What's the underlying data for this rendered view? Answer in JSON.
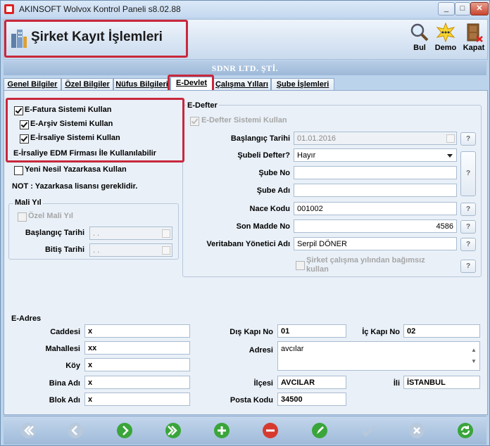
{
  "window": {
    "title": "AKINSOFT Wolvox Kontrol Paneli s8.02.88",
    "minimize": "_",
    "maximize": "□",
    "close": "✕"
  },
  "header": {
    "title": "Şirket Kayıt İşlemleri",
    "buttons": [
      {
        "label": "Bul",
        "icon": "magnifier-icon"
      },
      {
        "label": "Demo",
        "icon": "star-burst-icon"
      },
      {
        "label": "Kapat",
        "icon": "door-exit-icon"
      }
    ]
  },
  "company_name": "SDNR LTD. ŞTİ.",
  "tabs": [
    "Genel Bilgiler",
    "Özel Bilgiler",
    "Nüfus Bilgileri",
    "E-Devlet",
    "Çalışma Yılları",
    "Şube İşlemleri"
  ],
  "active_tab": "E-Devlet",
  "edevlet": {
    "efatura": "E-Fatura Sistemi Kullan",
    "earsiv": "E-Arşiv Sistemi Kullan",
    "eirsaliye": "E-İrsaliye Sistemi Kullan",
    "edm_note": "E-İrsaliye EDM Firması İle Kullanılabilir",
    "yeni_nesil": "Yeni Nesil Yazarkasa Kullan",
    "not_text": "NOT : Yazarkasa lisansı gereklidir."
  },
  "mali_yil": {
    "title": "Mali Yıl",
    "ozel": "Özel Mali Yıl",
    "baslangic_label": "Başlangıç Tarihi",
    "baslangic_value": ". .",
    "bitis_label": "Bitiş Tarihi",
    "bitis_value": ". ."
  },
  "edefter": {
    "title": "E-Defter",
    "kullan": "E-Defter Sistemi Kullan",
    "baslangic_label": "Başlangıç Tarihi",
    "baslangic_value": "01.01.2016",
    "subeli_label": "Şubeli Defter?",
    "subeli_value": "Hayır",
    "sube_no_label": "Şube No",
    "sube_no_value": "",
    "sube_adi_label": "Şube Adı",
    "sube_adi_value": "",
    "nace_label": "Nace Kodu",
    "nace_value": "001002",
    "son_madde_label": "Son Madde No",
    "son_madde_value": "4586",
    "yonetici_label": "Veritabanı Yönetici Adı",
    "yonetici_value": "Serpil DÖNER",
    "bagimsiz": "Şirket çalışma yılından bağımsız kullan",
    "q": "?"
  },
  "eadres": {
    "title": "E-Adres",
    "caddesi_label": "Caddesi",
    "caddesi_value": "x",
    "mahallesi_label": "Mahallesi",
    "mahallesi_value": "xx",
    "koy_label": "Köy",
    "koy_value": "x",
    "bina_label": "Bina Adı",
    "bina_value": "x",
    "blok_label": "Blok Adı",
    "blok_value": "x",
    "dis_kapi_label": "Dış Kapı No",
    "dis_kapi_value": "01",
    "ic_kapi_label": "İç Kapı No",
    "ic_kapi_value": "02",
    "adresi_label": "Adresi",
    "adresi_value": "avcılar",
    "ilcesi_label": "İlçesi",
    "ilcesi_value": "AVCILAR",
    "ili_label": "İli",
    "ili_value": "İSTANBUL",
    "posta_label": "Posta Kodu",
    "posta_value": "34500"
  },
  "footer_buttons": [
    "first-record-icon",
    "previous-record-icon",
    "next-record-icon",
    "last-record-icon",
    "add-record-icon",
    "delete-record-icon",
    "edit-record-icon",
    "save-record-icon",
    "cancel-record-icon",
    "refresh-icon"
  ]
}
